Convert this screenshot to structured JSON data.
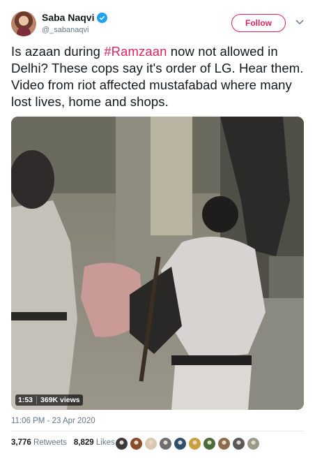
{
  "author": {
    "name": "Saba Naqvi",
    "handle": "@_sabanaqvi",
    "verified": true,
    "follow_label": "Follow"
  },
  "tweet": {
    "text_before": "Is azaan during ",
    "hashtag": "#Ramzaan",
    "text_after": " now not allowed in Delhi? These cops say it's order of LG. Hear them. Video from riot affected mustafabad where many lost lives, home and shops."
  },
  "video": {
    "duration": "1:53",
    "views": "369K views"
  },
  "timestamp": "11:06 PM - 23 Apr 2020",
  "stats": {
    "retweets_count": "3,776",
    "retweets_label": "Retweets",
    "likes_count": "8,829",
    "likes_label": "Likes"
  },
  "likers": [
    "#3b3b3b",
    "#8a4b2a",
    "#d9c9b0",
    "#6e6e6e",
    "#2f4f6f",
    "#c9a03b",
    "#4a6b3a",
    "#8c6b4a",
    "#5a5a5a",
    "#9a9a8a"
  ],
  "colors": {
    "accent": "#e0245e",
    "verified": "#1da1f2",
    "muted": "#657786"
  }
}
